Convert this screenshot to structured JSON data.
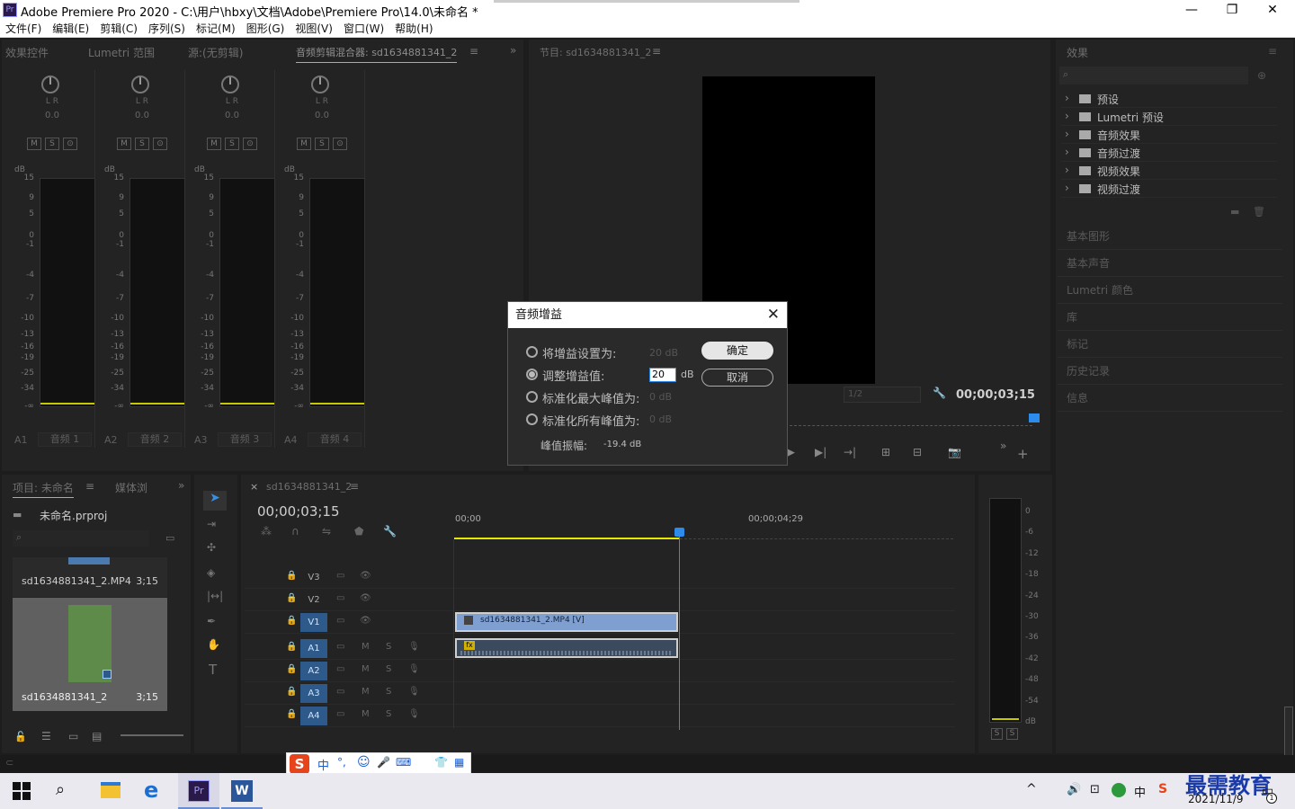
{
  "window": {
    "title": "Adobe Premiere Pro 2020 - C:\\用户\\hbxy\\文档\\Adobe\\Premiere Pro\\14.0\\未命名 *",
    "app_icon": "Pr"
  },
  "menu": [
    "文件(F)",
    "编辑(E)",
    "剪辑(C)",
    "序列(S)",
    "标记(M)",
    "图形(G)",
    "视图(V)",
    "窗口(W)",
    "帮助(H)"
  ],
  "source_panel": {
    "tabs": [
      "效果控件",
      "Lumetri 范围",
      "源:(无剪辑)",
      "音频剪辑混合器: sd1634881341_2"
    ],
    "channels": [
      {
        "id": "A1",
        "name": "音频 1",
        "value": "0.0"
      },
      {
        "id": "A2",
        "name": "音频 2",
        "value": "0.0"
      },
      {
        "id": "A3",
        "name": "音频 3",
        "value": "0.0"
      },
      {
        "id": "A4",
        "name": "音频 4",
        "value": "0.0"
      }
    ],
    "lr_label": "L    R",
    "msb": [
      "M",
      "S",
      "⊙"
    ],
    "db_label": "dB",
    "scale": [
      "15",
      "9",
      "5",
      "0",
      "-1",
      "-4",
      "-7",
      "-10",
      "-13",
      "-16",
      "-19",
      "-25",
      "-34",
      "-∞"
    ]
  },
  "program_panel": {
    "tab": "节目: sd1634881341_2",
    "timecode": "00;00;03;15",
    "resolution": "1/2"
  },
  "effects_panel": {
    "title": "效果",
    "items": [
      "预设",
      "Lumetri 预设",
      "音频效果",
      "音频过渡",
      "视频效果",
      "视频过渡"
    ],
    "sections": [
      "基本图形",
      "基本声音",
      "Lumetri 颜色",
      "库",
      "标记",
      "历史记录",
      "信息"
    ]
  },
  "project_panel": {
    "tabs": [
      "项目: 未命名",
      "媒体浏"
    ],
    "project_file": "未命名.prproj",
    "items": [
      {
        "name": "sd1634881341_2.MP4",
        "duration": "3;15"
      },
      {
        "name": "sd1634881341_2",
        "duration": "3;15"
      }
    ]
  },
  "timeline": {
    "tab": "sd1634881341_2",
    "timecode": "00;00;03;15",
    "ruler": [
      "00;00",
      "00;00;04;29"
    ],
    "video_tracks": [
      "V3",
      "V2",
      "V1"
    ],
    "audio_tracks": [
      "A1",
      "A2",
      "A3",
      "A4"
    ],
    "clip_video": "sd1634881341_2.MP4 [V]",
    "fx_badge": "fx",
    "ms_labels": [
      "M",
      "S"
    ]
  },
  "audio_meter": {
    "scale": [
      "0",
      "-6",
      "-12",
      "-18",
      "-24",
      "-30",
      "-36",
      "-42",
      "-48",
      "-54",
      "dB"
    ],
    "buttons": [
      "S",
      "S"
    ]
  },
  "dialog": {
    "title": "音频增益",
    "options": [
      {
        "label": "将增益设置为:",
        "value": "20 dB",
        "selected": false
      },
      {
        "label": "调整增益值:",
        "value": "20",
        "unit": "dB",
        "selected": true
      },
      {
        "label": "标准化最大峰值为:",
        "value": "0 dB",
        "selected": false
      },
      {
        "label": "标准化所有峰值为:",
        "value": "0 dB",
        "selected": false
      }
    ],
    "peak_label": "峰值振幅:",
    "peak_value": "-19.4 dB",
    "ok": "确定",
    "cancel": "取消"
  },
  "ime_bar": [
    "S",
    "中",
    "°,",
    "☺",
    "🎤",
    "⌨",
    "👕",
    "▦"
  ],
  "taskbar": {
    "tray": [
      "^",
      "🔊",
      "⊡",
      "中",
      "S"
    ],
    "date": "2021/11/9",
    "watermark": "最需教育",
    "notify_count": "1"
  },
  "colors": {
    "accent": "#2d8ceb",
    "video_clip": "#7f9fd0",
    "audio_clip": "#3c4a5e",
    "playhead": "#2d8ceb",
    "work_area": "#e6e600"
  }
}
